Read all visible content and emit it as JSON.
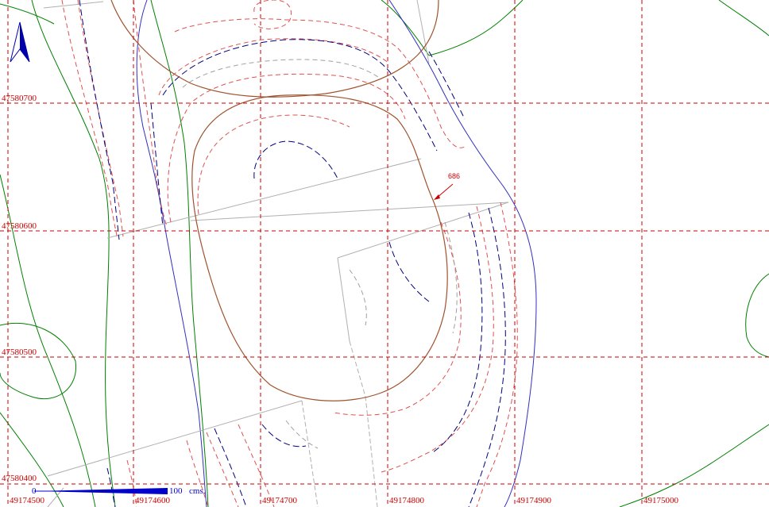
{
  "grid": {
    "x_labels": [
      "49174500",
      "49174600",
      "49174700",
      "49174800",
      "49174900",
      "49175000"
    ],
    "y_labels": [
      "47580700",
      "47580600",
      "47580500",
      "47580400"
    ]
  },
  "annotation": {
    "label": "686"
  },
  "scale_bar": {
    "start_label": "0",
    "end_label": "100",
    "unit": "cms."
  },
  "north_arrow": {
    "icon": "north-arrow-icon"
  },
  "colors": {
    "grid": "#cc0000",
    "contour_red": "#e05050",
    "contour_blue": "#000080",
    "contour_gray": "#a0a0a0",
    "contour_brown": "#a0522d",
    "green_line": "#008000",
    "blue_line": "#3030c0",
    "scale": "#0000cc"
  }
}
